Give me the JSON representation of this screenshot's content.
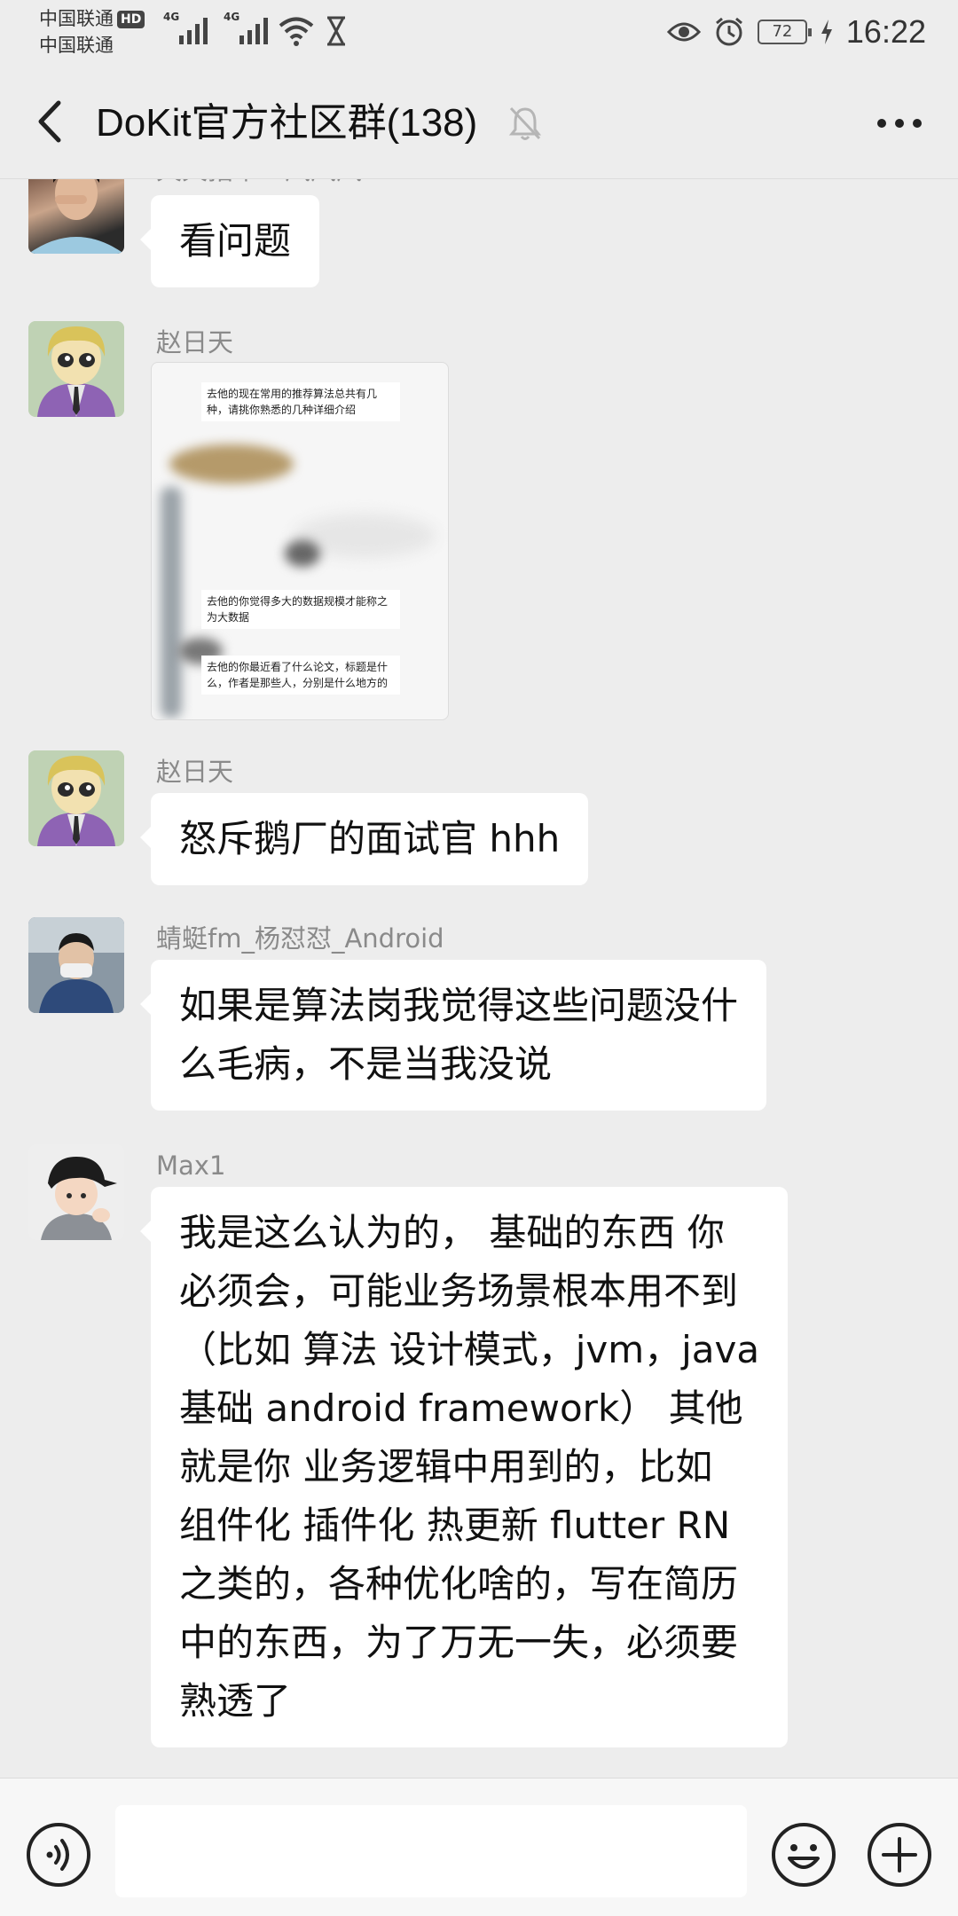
{
  "status_bar": {
    "carrier_1": "中国联通",
    "hd_badge": "HD",
    "carrier_2": "中国联通",
    "network_1": "4G",
    "network_2": "4G",
    "battery": "72",
    "time": "16:22"
  },
  "header": {
    "title": "DoKit官方社区群(138)",
    "icons": [
      "back-arrow-icon",
      "bell-muted-icon",
      "more-dots-icon"
    ]
  },
  "messages": [
    {
      "sender": "天天指草一风风风",
      "text": "看问题"
    },
    {
      "sender": "赵日天",
      "image_captions": [
        "去他的现在常用的推荐算法总共有几种，请挑你熟悉的几种详细介绍",
        "去他的你觉得多大的数据规模才能称之为大数据",
        "去他的你最近看了什么论文，标题是什么，作者是那些人，分别是什么地方的"
      ]
    },
    {
      "sender": "赵日天",
      "text": "怒斥鹅厂的面试官 hhh"
    },
    {
      "sender": "蜻蜓fm_杨怼怼_Android",
      "lines": [
        "如果是算法岗我觉得这些问题没什",
        "么毛病，不是当我没说"
      ]
    },
    {
      "sender": "Max1",
      "lines": [
        "我是这么认为的， 基础的东西  你",
        "必须会，可能业务场景根本用不到",
        "（比如  算法 设计模式，jvm，java",
        "基础  android framework）  其他",
        "就是你 业务逻辑中用到的，比如",
        "组件化 插件化  热更新 flutter RN",
        "之类的，各种优化啥的，写在简历",
        "中的东西，为了万无一失，必须要",
        "熟透了"
      ]
    }
  ],
  "input_bar": {
    "value": "",
    "icons": [
      "voice-icon",
      "emoji-icon",
      "plus-icon"
    ]
  },
  "colors": {
    "background": "#ededed",
    "bubble": "#ffffff",
    "sender_name": "#8a8a8a"
  }
}
